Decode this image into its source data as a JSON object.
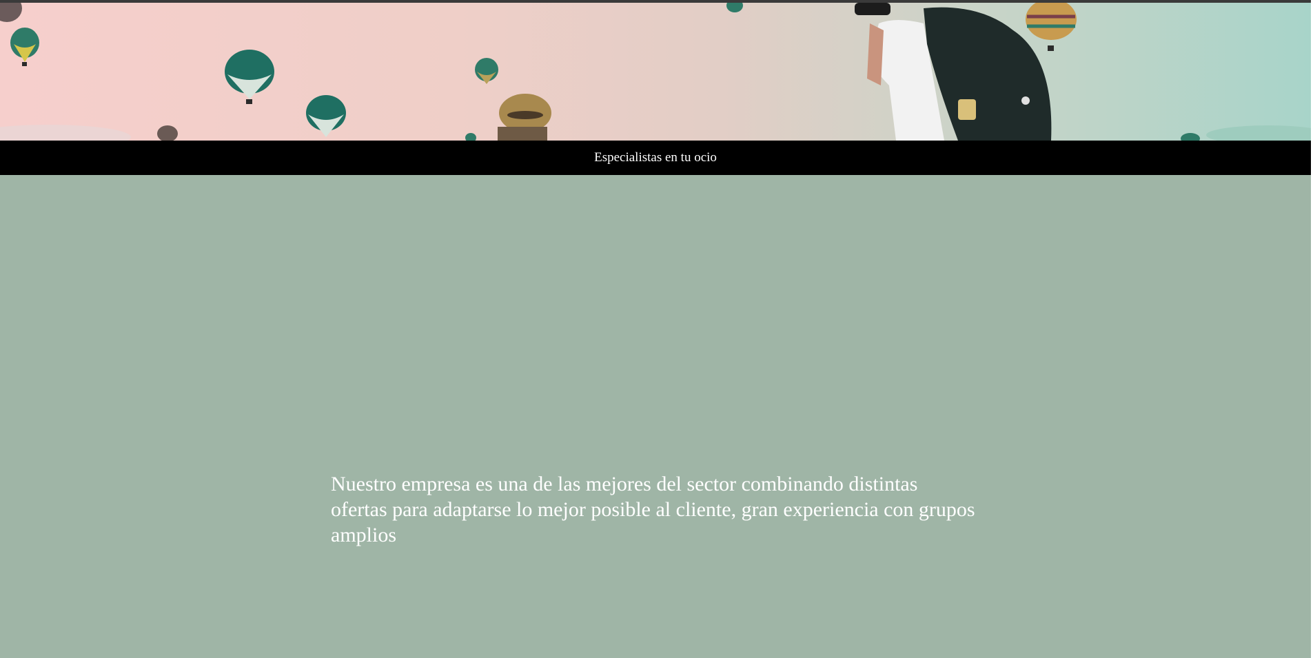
{
  "hero": {
    "image_alt": "Globos aerostáticos y fotógrafo con mochila",
    "colors": {
      "sky_left": "#f6cfcc",
      "sky_right": "#a8d4c9",
      "balloon": "#1f6f62"
    }
  },
  "tagline": {
    "text": "Especialistas en tu ocio",
    "background": "#000000",
    "color": "#ffffff"
  },
  "main": {
    "background": "#9fb5a6",
    "intro_text": "Nuestro empresa es una de las mejores del sector combinando distintas ofertas para adaptarse lo mejor posible al cliente, gran experiencia con grupos amplios"
  }
}
